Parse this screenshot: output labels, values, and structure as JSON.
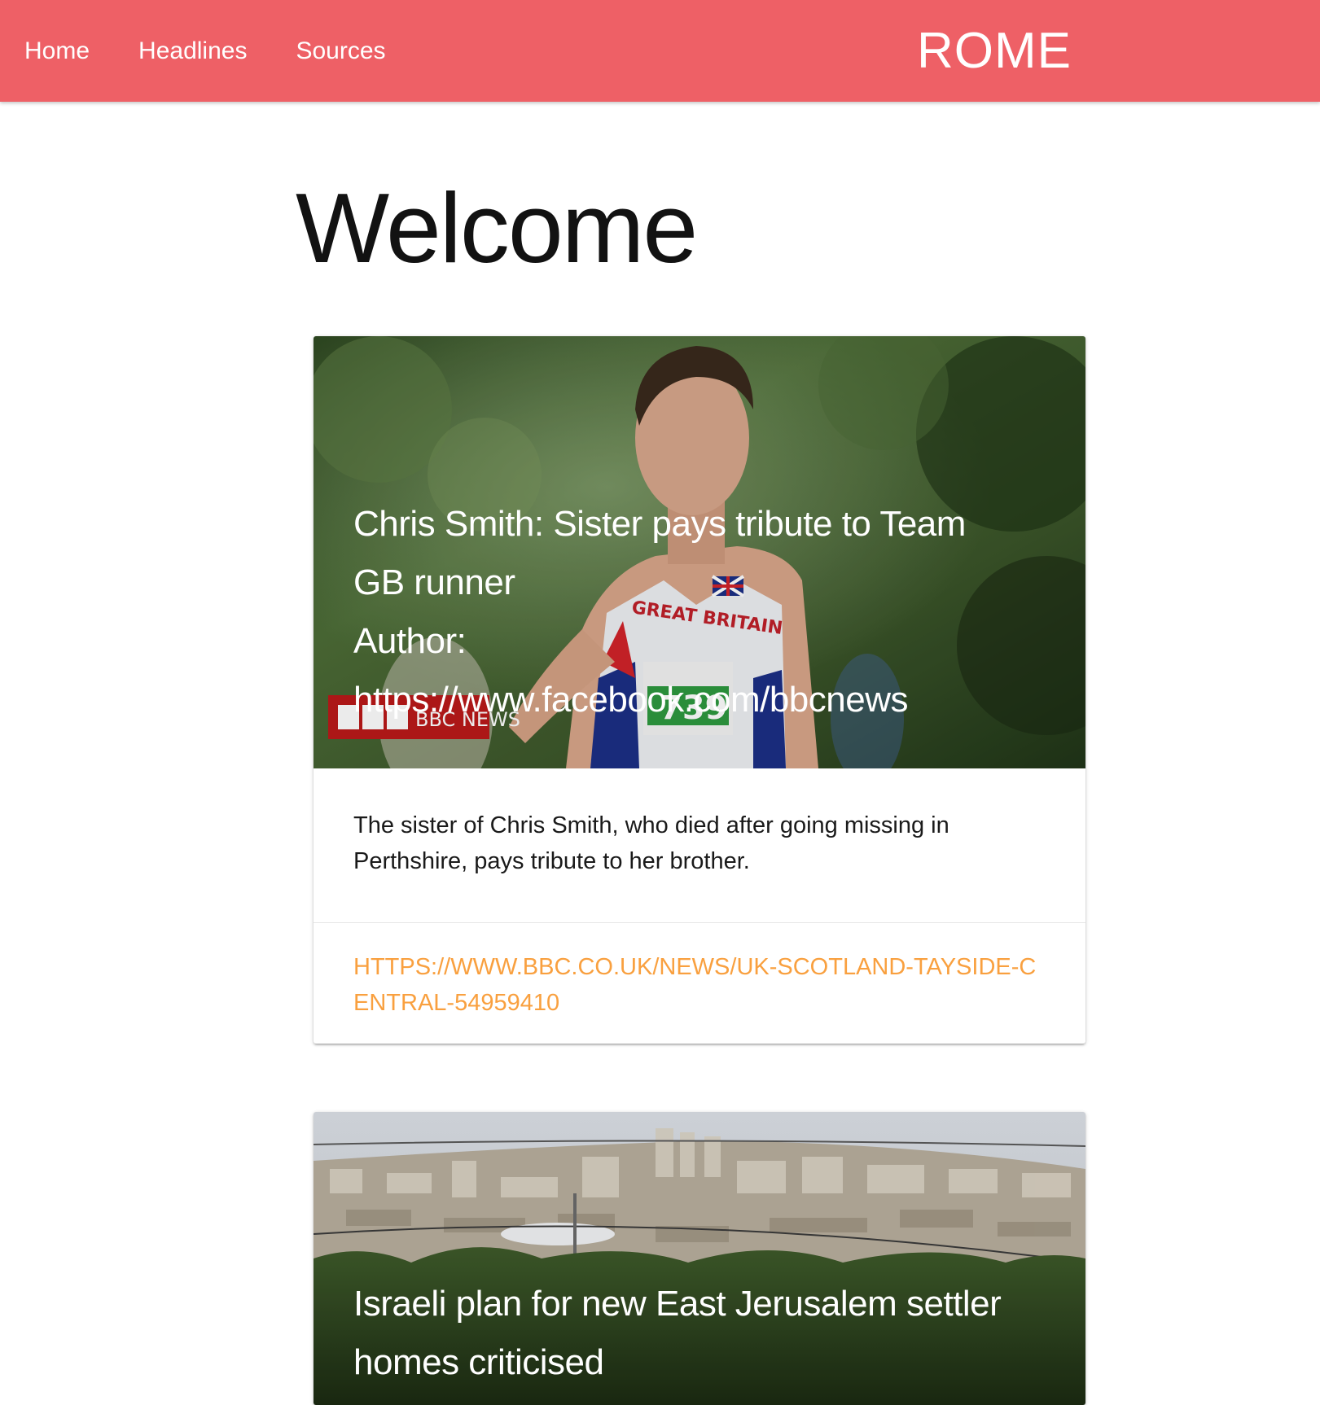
{
  "nav": {
    "links": [
      {
        "label": "Home"
      },
      {
        "label": "Headlines"
      },
      {
        "label": "Sources"
      }
    ],
    "brand": "ROME"
  },
  "main": {
    "title": "Welcome"
  },
  "articles": [
    {
      "title": "Chris Smith: Sister pays tribute to Team GB runner",
      "author_label": "Author:",
      "author": "https://www.facebook.com/bbcnews",
      "image_logo_text": "BBC NEWS",
      "image_vest_text": "GREAT BRITAIN",
      "image_bib_text": "739",
      "description": "The sister of Chris Smith, who died after going missing in Perthshire, pays tribute to her brother.",
      "url": "https://www.bbc.co.uk/news/uk-scotland-tayside-central-54959410"
    },
    {
      "title": "Israeli plan for new East Jerusalem settler homes criticised"
    }
  ],
  "colors": {
    "navbar": "#ee6066",
    "link": "#f9a03f"
  }
}
